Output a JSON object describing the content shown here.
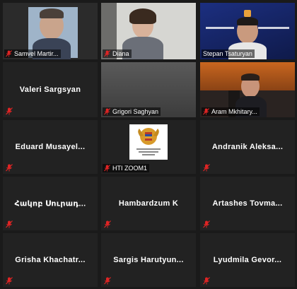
{
  "participants": [
    {
      "name": "Samvel Martir...",
      "muted": true
    },
    {
      "name": "Diana",
      "muted": true
    },
    {
      "name": "Stepan Tsaturyan",
      "muted": false
    },
    {
      "name": "Valeri Sargsyan",
      "muted": true
    },
    {
      "name": "Grigori Saghyan",
      "muted": true
    },
    {
      "name": "Aram Mkhitary...",
      "muted": true
    },
    {
      "name": "Eduard Musayel...",
      "muted": true
    },
    {
      "name": "HTI ZOOM1",
      "muted": true
    },
    {
      "name": "Andranik Aleksa...",
      "muted": true
    },
    {
      "name": "Հակոբ Սուրադ...",
      "muted": true
    },
    {
      "name": "Hambardzum K",
      "muted": true
    },
    {
      "name": "Artashes Tovma...",
      "muted": true
    },
    {
      "name": "Grisha Khachatr...",
      "muted": true
    },
    {
      "name": "Sargis Harutyun...",
      "muted": true
    },
    {
      "name": "Lyudmila Gevor...",
      "muted": true
    }
  ],
  "colors": {
    "background": "#1a1a1a",
    "tile": "#222222",
    "active_speaker_border": "#d4e25a",
    "muted_icon": "#e02424"
  }
}
